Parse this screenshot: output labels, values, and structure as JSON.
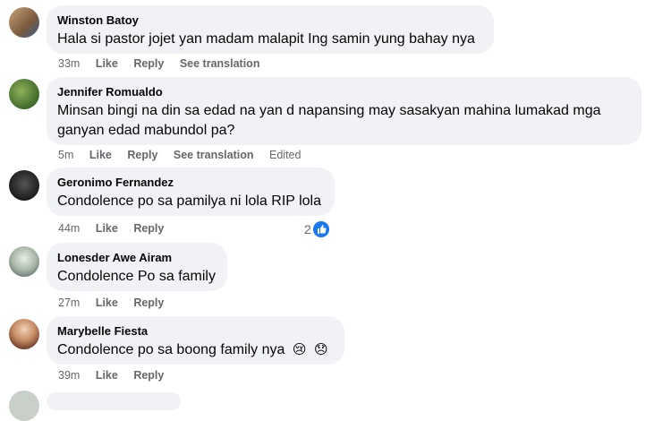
{
  "actions": {
    "like": "Like",
    "reply": "Reply",
    "see_translation": "See translation",
    "edited": "Edited"
  },
  "comments": [
    {
      "author": "Winston Batoy",
      "text": "Hala si pastor jojet yan madam malapit Ing samin yung bahay nya",
      "time": "33m"
    },
    {
      "author": "Jennifer Romualdo",
      "text": "Minsan bingi na din sa edad na yan d napansing may sasakyan mahina lumakad mga ganyan edad mabundol pa?",
      "time": "5m"
    },
    {
      "author": "Geronimo Fernandez",
      "text": "Condolence po sa pamilya ni lola RIP lola",
      "time": "44m",
      "reactions": "2"
    },
    {
      "author": "Lonesder Awe Airam",
      "text": "Condolence Po sa family",
      "time": "27m"
    },
    {
      "author": "Marybelle Fiesta",
      "text": "Condolence po sa boong family nya",
      "time": "39m",
      "emojis": [
        "😢",
        "😞"
      ]
    }
  ],
  "icons": {
    "reaction": "like-reaction-icon"
  },
  "colors": {
    "bubble": "#f0f2f5",
    "meta": "#65676b",
    "like_blue": "#1877f2"
  }
}
